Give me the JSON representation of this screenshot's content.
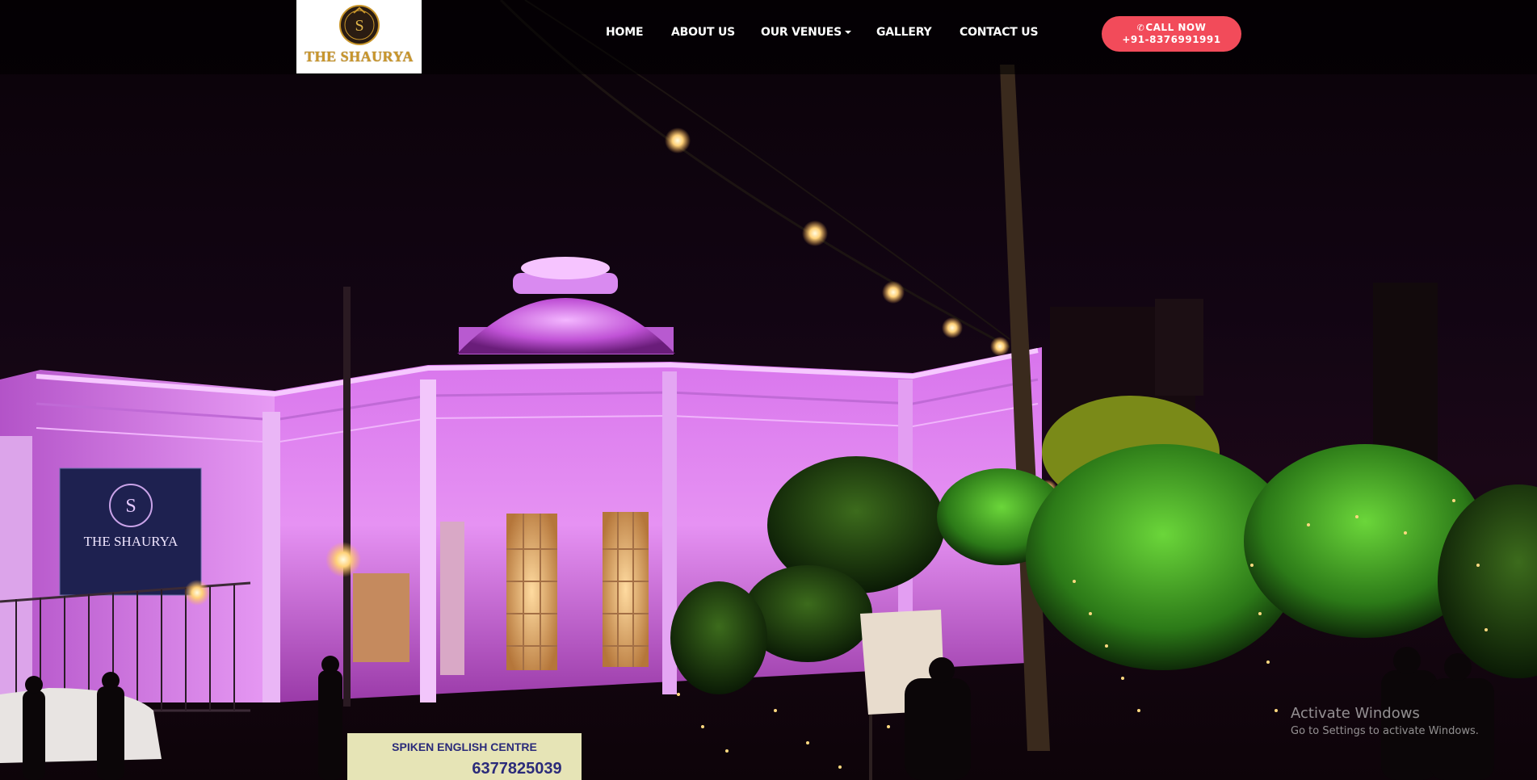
{
  "brand": {
    "name": "THE SHAURYA",
    "emblem_letter": "S"
  },
  "nav": {
    "items": [
      {
        "label": "HOME"
      },
      {
        "label": "ABOUT US"
      },
      {
        "label": "OUR VENUES"
      },
      {
        "label": "GALLERY"
      },
      {
        "label": "CONTACT US"
      }
    ]
  },
  "call_button": {
    "line1": "CALL NOW",
    "line2": "+91-8376991991",
    "icon": "phone-icon"
  },
  "hero": {
    "building_sign": {
      "title": "THE SHAURYA",
      "letter": "S"
    },
    "street_sign": {
      "text1": "SPIKEN ENGLISH CENTRE",
      "text2": "6377825039"
    }
  },
  "watermark": {
    "line1": "Activate Windows",
    "line2": "Go to Settings to activate Windows."
  },
  "colors": {
    "accent": "#f24b5a",
    "gold": "#c9962b",
    "venue_glow": "#e07ef0"
  }
}
